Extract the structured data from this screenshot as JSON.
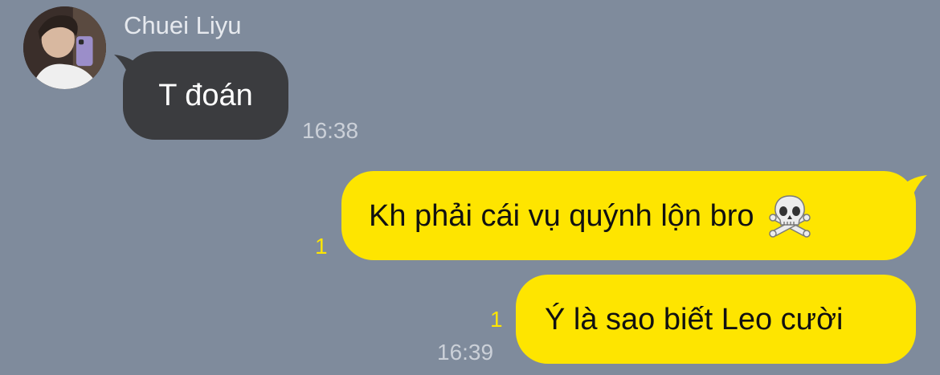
{
  "chat": {
    "sender_name": "Chuei Liyu",
    "avatar_icon": "profile-photo",
    "colors": {
      "background": "#7f8b9c",
      "incoming_bubble": "#3b3c3f",
      "outgoing_bubble": "#fee500",
      "unread_count": "#fee500"
    },
    "messages": [
      {
        "direction": "incoming",
        "text": "T đoán",
        "time": "16:38"
      },
      {
        "direction": "outgoing",
        "text": "Kh phải cái vụ quýnh lộn bro",
        "emoji": "skull-and-crossbones-icon",
        "unread": "1"
      },
      {
        "direction": "outgoing",
        "text": "Ý là sao biết Leo cười",
        "unread": "1",
        "time": "16:39"
      }
    ]
  }
}
